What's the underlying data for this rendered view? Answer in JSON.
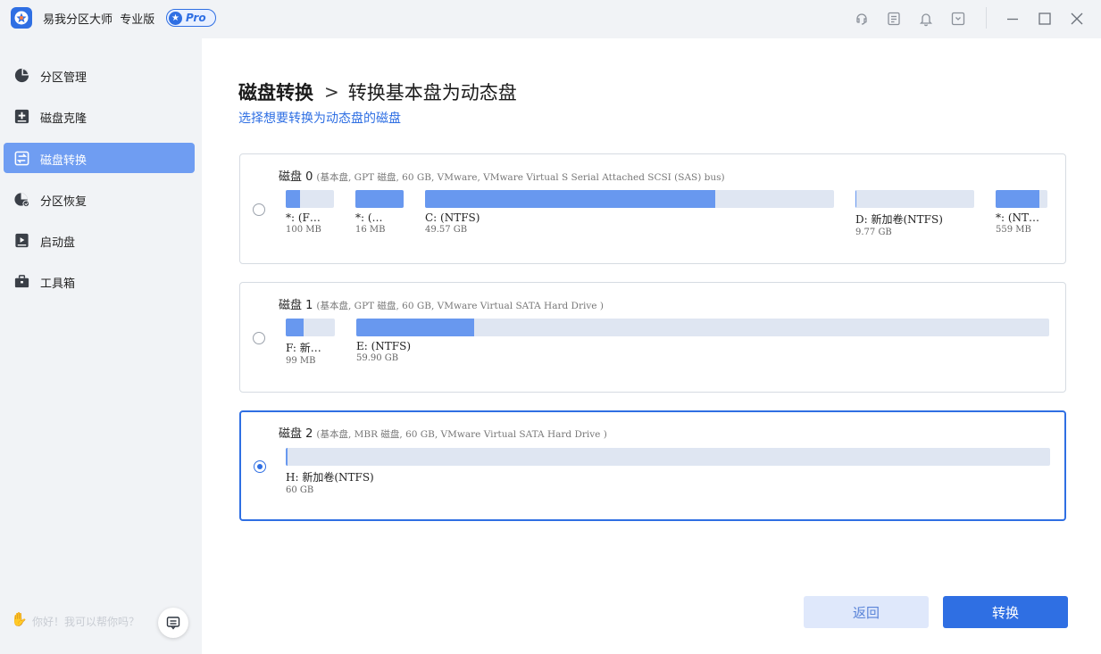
{
  "app": {
    "title": "易我分区大师  专业版",
    "badge": "Pro"
  },
  "sidebar": {
    "items": [
      {
        "label": "分区管理",
        "icon": "pie-chart-icon",
        "active": false
      },
      {
        "label": "磁盘克隆",
        "icon": "disk-clone-icon",
        "active": false
      },
      {
        "label": "磁盘转换",
        "icon": "disk-convert-icon",
        "active": true
      },
      {
        "label": "分区恢复",
        "icon": "partition-recovery-icon",
        "active": false
      },
      {
        "label": "启动盘",
        "icon": "boot-disk-icon",
        "active": false
      },
      {
        "label": "工具箱",
        "icon": "toolbox-icon",
        "active": false
      }
    ],
    "help_text": "你好！我可以帮你吗？"
  },
  "main": {
    "breadcrumb_root": "磁盘转换",
    "breadcrumb_sep": ">",
    "breadcrumb_current": "转换基本盘为动态盘",
    "subtitle": "选择想要转换为动态盘的磁盘"
  },
  "disks": [
    {
      "name": "磁盘 0",
      "info": "(基本盘, GPT 磁盘, 60 GB, VMware,  VMware Virtual S Serial Attached SCSI (SAS) bus)",
      "selected": false,
      "partitions": [
        {
          "label": "*: (F…",
          "size": "100 MB",
          "used": 0.3
        },
        {
          "label": "*: (…",
          "size": "16 MB",
          "used": 1.0
        },
        {
          "label": "C: (NTFS)",
          "size": "49.57 GB",
          "used": 0.71
        },
        {
          "label": "D: 新加卷(NTFS)",
          "size": "9.77 GB",
          "used": 0.01
        },
        {
          "label": "*: (NT…",
          "size": "559 MB",
          "used": 0.85
        }
      ]
    },
    {
      "name": "磁盘 1",
      "info": "(基本盘, GPT 磁盘, 60 GB, VMware Virtual SATA Hard Drive )",
      "selected": false,
      "partitions": [
        {
          "label": "F: 新…",
          "size": "99 MB",
          "used": 0.37
        },
        {
          "label": "E: (NTFS)",
          "size": "59.90 GB",
          "used": 0.17
        }
      ]
    },
    {
      "name": "磁盘 2",
      "info": "(基本盘, MBR 磁盘, 60 GB, VMware Virtual SATA Hard Drive )",
      "selected": true,
      "partitions": [
        {
          "label": "H: 新加卷(NTFS)",
          "size": "60 GB",
          "used": 0.002
        }
      ]
    }
  ],
  "buttons": {
    "back": "返回",
    "convert": "转换"
  },
  "colors": {
    "accent": "#2f6fe3",
    "sidebar_active": "#6f9df2",
    "bar_fill": "#6898ef",
    "bar_bg": "#dfe6f2"
  }
}
